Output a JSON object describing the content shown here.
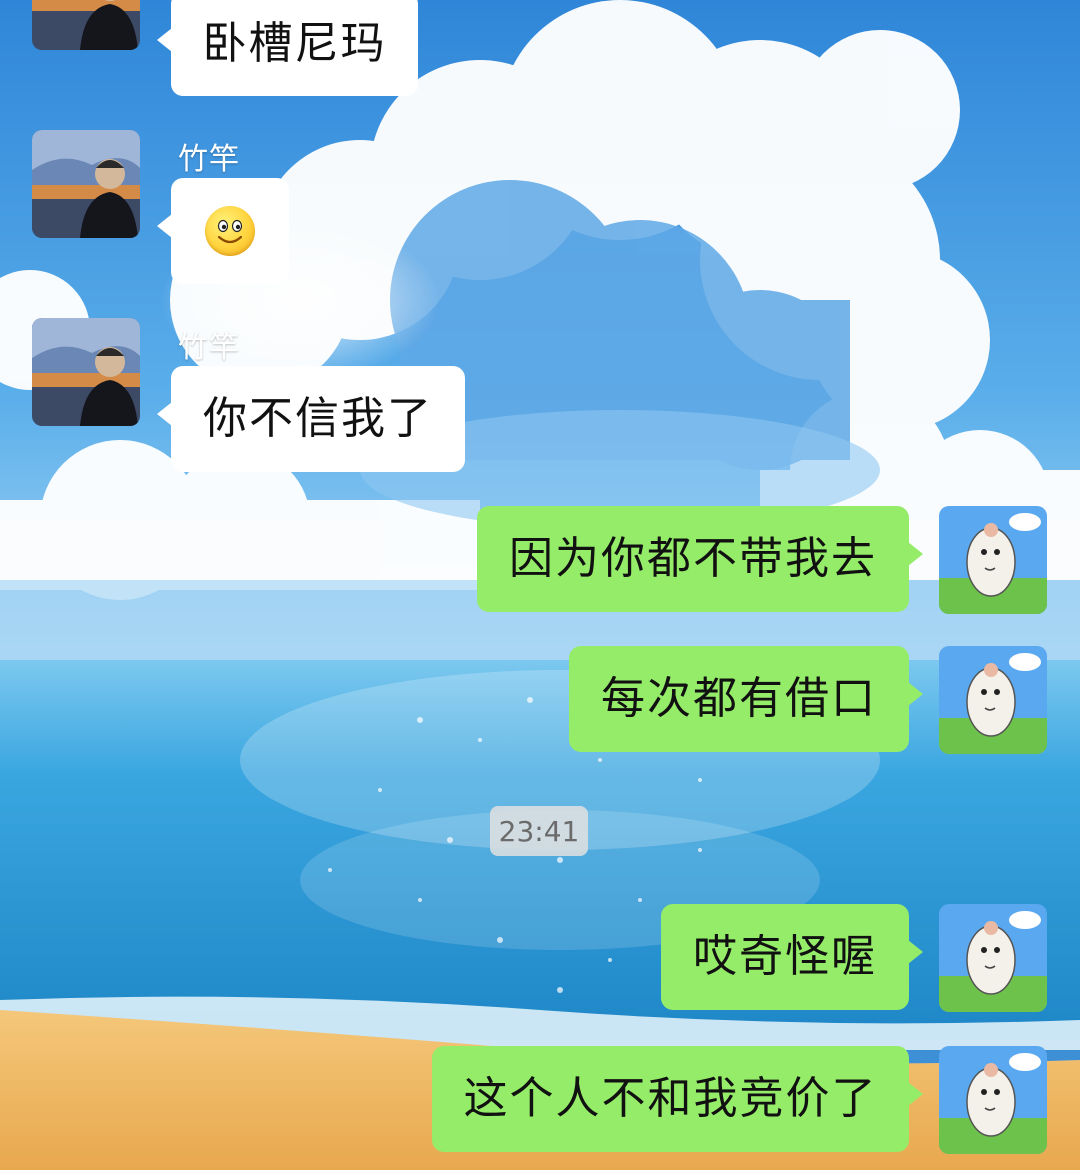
{
  "timestamp": "23:41",
  "messages": [
    {
      "side": "in",
      "sender": "",
      "text": "卧槽尼玛"
    },
    {
      "side": "in",
      "sender": "竹竿",
      "text": "",
      "emoji": "smile-emoji"
    },
    {
      "side": "in",
      "sender": "竹竿",
      "text": "你不信我了"
    },
    {
      "side": "out",
      "text": "因为你都不带我去"
    },
    {
      "side": "out",
      "text": "每次都有借口"
    },
    {
      "side": "out",
      "text": "哎奇怪喔"
    },
    {
      "side": "out",
      "text": "这个人不和我竞价了"
    }
  ],
  "colors": {
    "incoming_bubble": "#ffffff",
    "outgoing_bubble": "#95ec69",
    "sky": "#3d8fd6",
    "sea": "#2a9fd9",
    "sand": "#f0b860"
  }
}
